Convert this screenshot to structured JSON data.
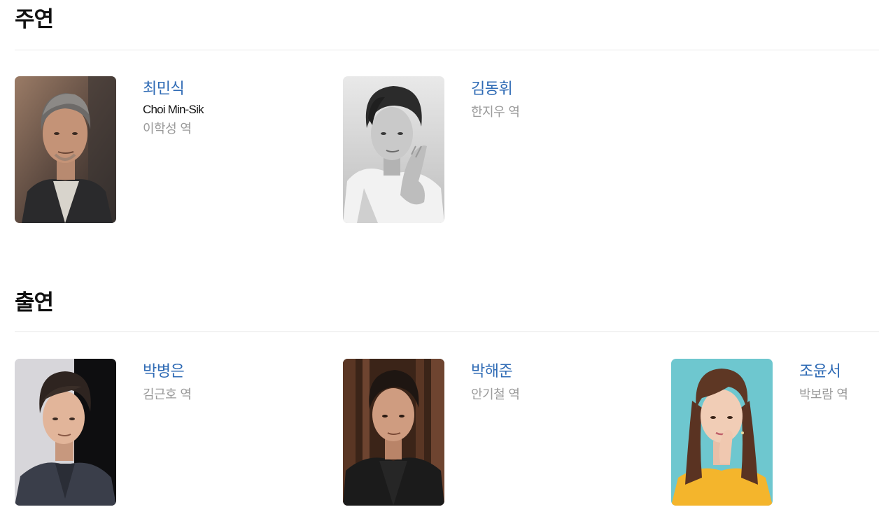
{
  "sections": [
    {
      "title": "주연",
      "cast": [
        {
          "name": "최민식",
          "english_name": "Choi Min-Sik",
          "role": "이학성 역",
          "photo_tone": "color"
        },
        {
          "name": "김동휘",
          "english_name": "",
          "role": "한지우 역",
          "photo_tone": "monochrome"
        }
      ]
    },
    {
      "title": "출연",
      "cast": [
        {
          "name": "박병은",
          "english_name": "",
          "role": "김근호 역",
          "photo_tone": "color"
        },
        {
          "name": "박해준",
          "english_name": "",
          "role": "안기철 역",
          "photo_tone": "color"
        },
        {
          "name": "조윤서",
          "english_name": "",
          "role": "박보람 역",
          "photo_tone": "color"
        }
      ]
    }
  ],
  "colors": {
    "name_link": "#2f6bb5",
    "role_text": "#9a9a9a",
    "heading_text": "#111111",
    "divider": "#e8e8e8"
  }
}
